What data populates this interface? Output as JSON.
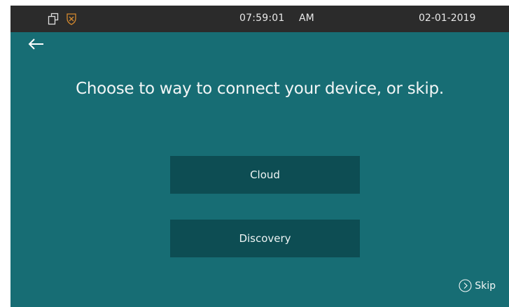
{
  "status_bar": {
    "time": "07:59:01",
    "ampm": "AM",
    "date": "02-01-2019",
    "icons": [
      "windows-icon",
      "shield-icon"
    ],
    "shield_color": "#d68a2e"
  },
  "nav": {
    "back_icon": "back-arrow-icon"
  },
  "main": {
    "headline": "Choose to way to connect your device, or skip.",
    "options": [
      {
        "label": "Cloud"
      },
      {
        "label": "Discovery"
      }
    ],
    "skip_label": "Skip",
    "skip_icon": "chevron-circle-right-icon"
  },
  "colors": {
    "background": "#176d74",
    "button": "#0d4d53",
    "status_bar": "#2b2b2b"
  }
}
